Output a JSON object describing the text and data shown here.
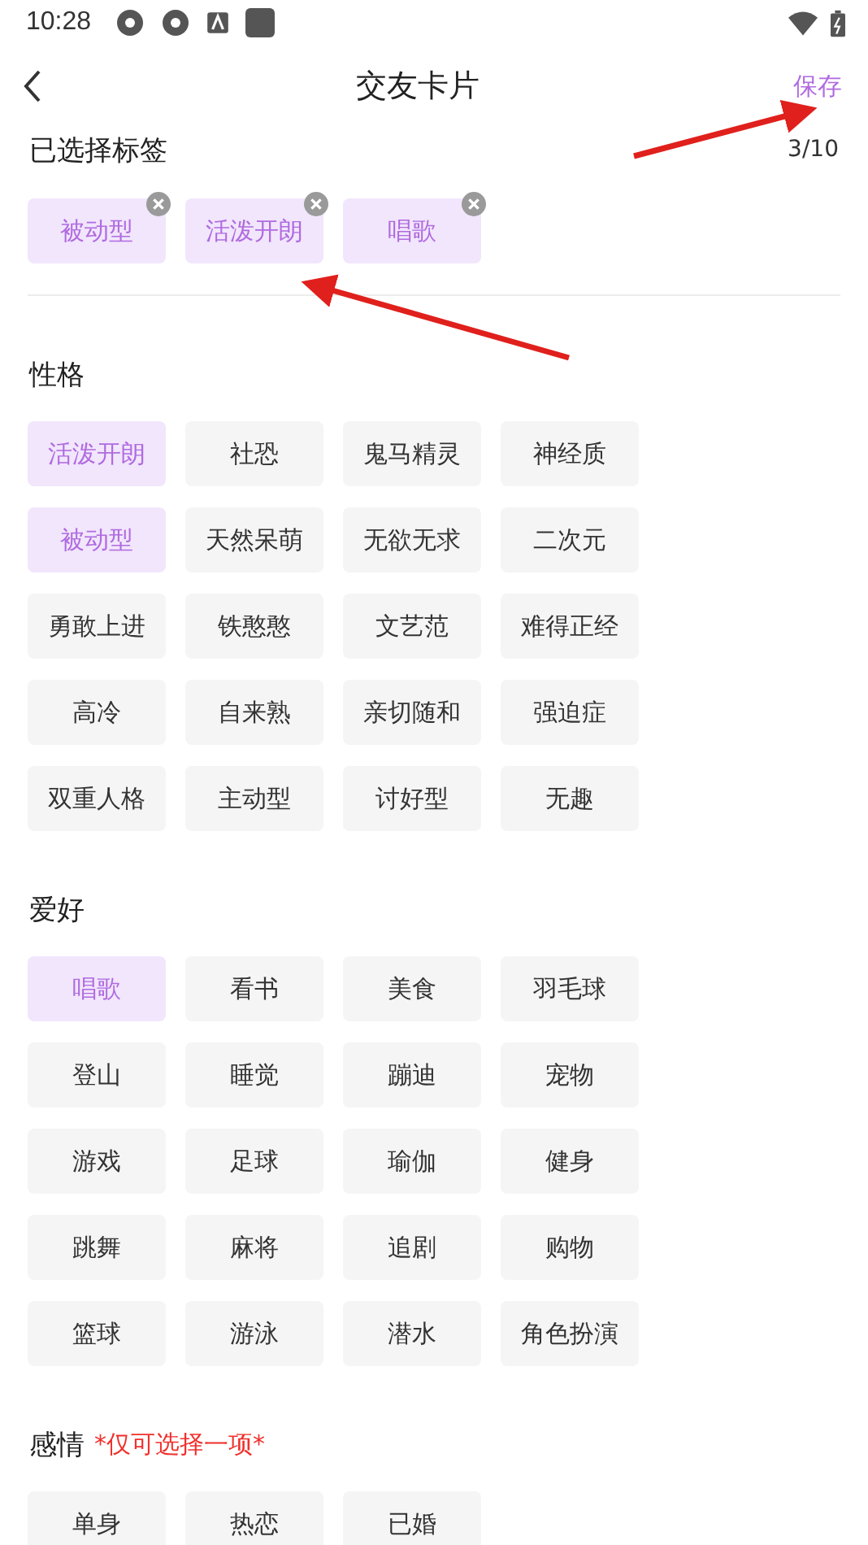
{
  "status_bar": {
    "time": "10:28"
  },
  "header": {
    "title": "交友卡片",
    "save": "保存"
  },
  "selected": {
    "label": "已选择标签",
    "count": "3/10",
    "tags": [
      {
        "label": "被动型"
      },
      {
        "label": "活泼开朗"
      },
      {
        "label": "唱歌"
      }
    ]
  },
  "sections": [
    {
      "title": "性格",
      "tags": [
        {
          "label": "活泼开朗",
          "selected": true
        },
        {
          "label": "社恐",
          "selected": false
        },
        {
          "label": "鬼马精灵",
          "selected": false
        },
        {
          "label": "神经质",
          "selected": false
        },
        {
          "label": "被动型",
          "selected": true
        },
        {
          "label": "天然呆萌",
          "selected": false
        },
        {
          "label": "无欲无求",
          "selected": false
        },
        {
          "label": "二次元",
          "selected": false
        },
        {
          "label": "勇敢上进",
          "selected": false
        },
        {
          "label": "铁憨憨",
          "selected": false
        },
        {
          "label": "文艺范",
          "selected": false
        },
        {
          "label": "难得正经",
          "selected": false
        },
        {
          "label": "高冷",
          "selected": false
        },
        {
          "label": "自来熟",
          "selected": false
        },
        {
          "label": "亲切随和",
          "selected": false
        },
        {
          "label": "强迫症",
          "selected": false
        },
        {
          "label": "双重人格",
          "selected": false
        },
        {
          "label": "主动型",
          "selected": false
        },
        {
          "label": "讨好型",
          "selected": false
        },
        {
          "label": "无趣",
          "selected": false
        }
      ]
    },
    {
      "title": "爱好",
      "tags": [
        {
          "label": "唱歌",
          "selected": true
        },
        {
          "label": "看书",
          "selected": false
        },
        {
          "label": "美食",
          "selected": false
        },
        {
          "label": "羽毛球",
          "selected": false
        },
        {
          "label": "登山",
          "selected": false
        },
        {
          "label": "睡觉",
          "selected": false
        },
        {
          "label": "蹦迪",
          "selected": false
        },
        {
          "label": "宠物",
          "selected": false
        },
        {
          "label": "游戏",
          "selected": false
        },
        {
          "label": "足球",
          "selected": false
        },
        {
          "label": "瑜伽",
          "selected": false
        },
        {
          "label": "健身",
          "selected": false
        },
        {
          "label": "跳舞",
          "selected": false
        },
        {
          "label": "麻将",
          "selected": false
        },
        {
          "label": "追剧",
          "selected": false
        },
        {
          "label": "购物",
          "selected": false
        },
        {
          "label": "篮球",
          "selected": false
        },
        {
          "label": "游泳",
          "selected": false
        },
        {
          "label": "潜水",
          "selected": false
        },
        {
          "label": "角色扮演",
          "selected": false
        }
      ]
    },
    {
      "title": "感情",
      "note": "*仅可选择一项*",
      "tags": [
        {
          "label": "单身",
          "selected": false
        },
        {
          "label": "热恋",
          "selected": false
        },
        {
          "label": "已婚",
          "selected": false
        }
      ]
    }
  ]
}
